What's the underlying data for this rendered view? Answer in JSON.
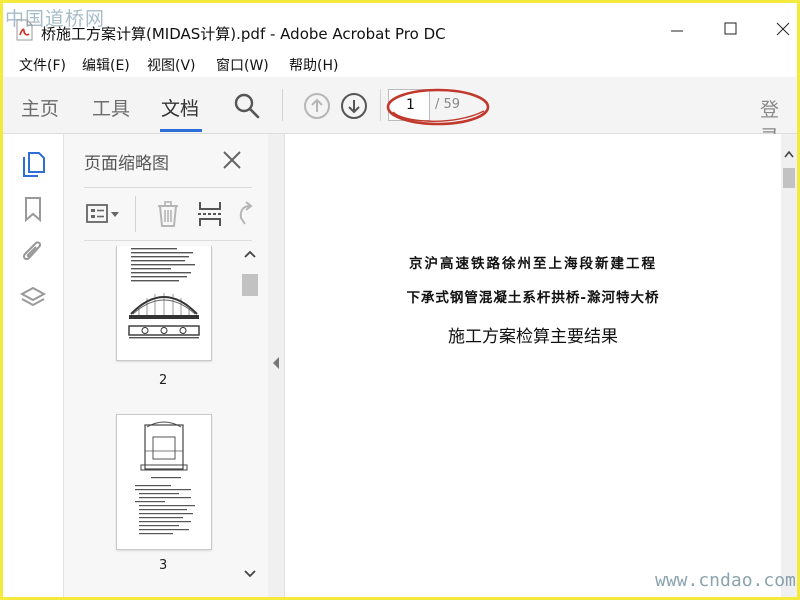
{
  "watermarks": {
    "top_left": "中国道桥网",
    "bottom_right": "www.cndao.com"
  },
  "window": {
    "title": "桥施工方案计算(MIDAS计算).pdf - Adobe Acrobat Pro DC"
  },
  "menu": {
    "items": [
      "文件(F)",
      "编辑(E)",
      "视图(V)",
      "窗口(W)",
      "帮助(H)"
    ]
  },
  "toolbar": {
    "tabs": [
      "主页",
      "工具",
      "文档"
    ],
    "active_tab": "文档",
    "page_current": "1",
    "page_total": "/ 59",
    "login_label": "登录",
    "accent_color": "#2d6fd6",
    "annotation_color": "#c0392b"
  },
  "left_rail": {
    "icons": [
      "pages-icon",
      "bookmark-icon",
      "attachment-icon",
      "layers-icon"
    ]
  },
  "thumbnail_panel": {
    "title": "页面缩略图",
    "thumbnails": [
      {
        "label": "2"
      },
      {
        "label": "3"
      }
    ]
  },
  "document": {
    "line1": "京沪高速铁路徐州至上海段新建工程",
    "line2": "下承式钢管混凝土系杆拱桥-滁河特大桥",
    "line3": "施工方案检算主要结果"
  }
}
